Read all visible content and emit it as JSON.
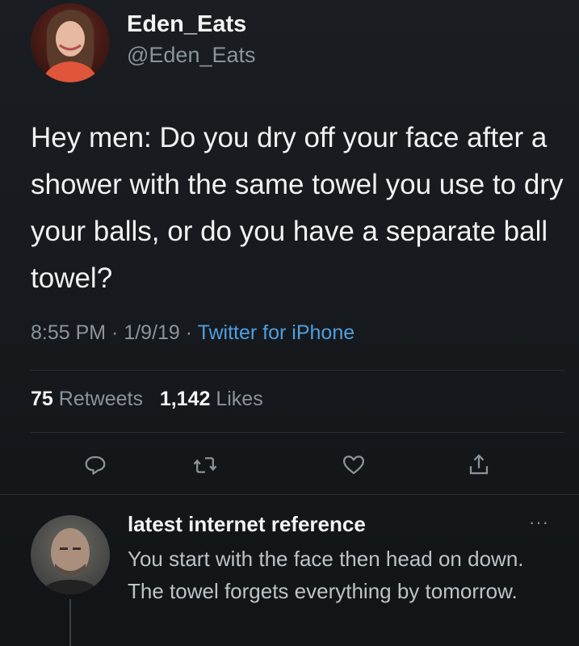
{
  "tweet": {
    "author_name": "Eden_Eats",
    "author_handle": "@Eden_Eats",
    "text": "Hey men: Do you dry off your face after a shower with the same towel you use to dry your balls, or do you have a separate ball towel?",
    "time": "8:55 PM",
    "date": "1/9/19",
    "source": "Twitter for iPhone",
    "separator": " · ",
    "retweets_count": "75",
    "retweets_label": "Retweets",
    "likes_count": "1,142",
    "likes_label": "Likes"
  },
  "actions": [
    {
      "name": "reply",
      "icon": "reply-icon"
    },
    {
      "name": "retweet",
      "icon": "retweet-icon"
    },
    {
      "name": "like",
      "icon": "heart-icon"
    },
    {
      "name": "share",
      "icon": "share-icon"
    }
  ],
  "reply": {
    "author_name": "latest internet reference",
    "text": "You start with the face then head on down. The towel forgets everything by tomorrow.",
    "more_icon": "more-icon"
  },
  "colors": {
    "background": "#15181c",
    "link": "#4f9fe0",
    "muted": "#8a949c",
    "text": "#f0f2f3"
  }
}
